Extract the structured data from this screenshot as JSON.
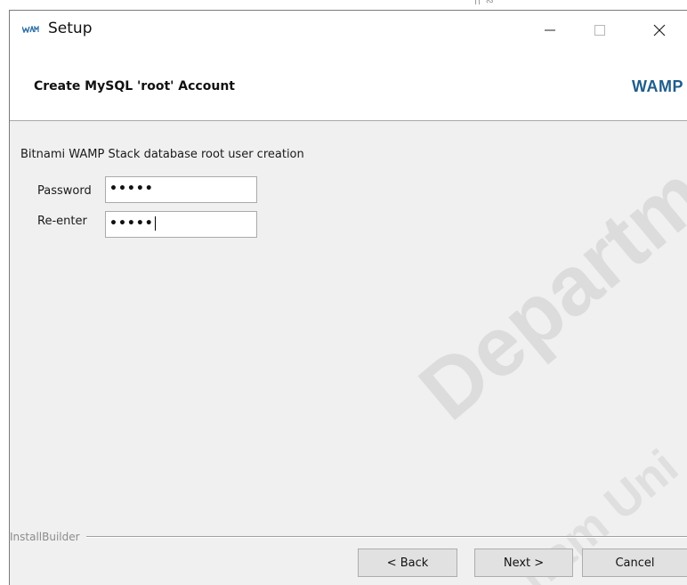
{
  "window": {
    "title": "Setup",
    "icon": "wamp-logo-icon",
    "controls": {
      "minimize": "minimize-icon",
      "maximize": "maximize-icon",
      "close": "close-icon"
    }
  },
  "header": {
    "title": "Create MySQL 'root' Account",
    "brand": "WAMP"
  },
  "form": {
    "description": "Bitnami WAMP Stack database root user creation",
    "password_label": "Password",
    "password_value": "•••••",
    "reenter_label": "Re-enter",
    "reenter_value": "•••••"
  },
  "footer": {
    "group_label": "InstallBuilder",
    "back_label": "< Back",
    "next_label": "Next >",
    "cancel_label": "Cancel"
  },
  "watermark": {
    "line1": "Departmen",
    "line2": "ham Uni"
  },
  "colors": {
    "brand": "#1f5d8c",
    "button_bg": "#e1e1e1",
    "window_bg": "#f0f0f0"
  }
}
